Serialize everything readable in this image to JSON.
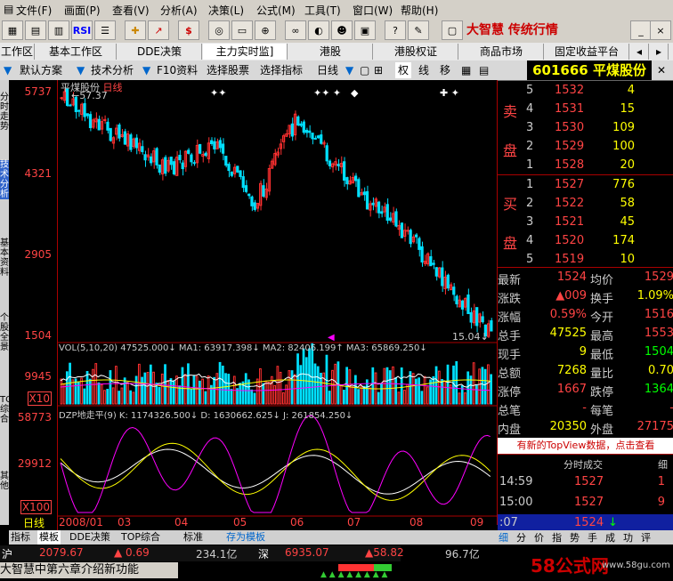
{
  "menu": {
    "items": [
      "文件(F)",
      "画面(P)",
      "查看(V)",
      "分析(A)",
      "决策(L)",
      "公式(M)",
      "工具(T)",
      "窗口(W)",
      "帮助(H)"
    ],
    "brand": "大智慧 传统行情"
  },
  "toolbar": {
    "rsi_label": "RSI",
    "dollar": "$"
  },
  "work_tabs": [
    "工作区",
    "基本工作区",
    "DDE决策",
    "主力实时监]",
    "港股",
    "港股权证",
    "商品市场",
    "固定收益平台"
  ],
  "func_bar": {
    "items": [
      "默认方案",
      "技术分析",
      "F10资料",
      "选择股票",
      "选择指标",
      "日线",
      "权",
      "线",
      "移"
    ],
    "stock_code": "601666",
    "stock_name": "平煤股份"
  },
  "side_labels": [
    "分时走势",
    "技术分析",
    "基本资料",
    "个股全景"
  ],
  "side_labels_lower": [
    "TOP综合",
    "其他"
  ],
  "chart": {
    "price_labels": [
      "5737",
      "4321",
      "2905",
      "1504"
    ],
    "title": "平煤股份",
    "period": "日线",
    "high_label": "57.37",
    "low_label": "15.04",
    "vol_legend": "VOL(5,10,20)  47525.000↓  MA1: 63917.398↓  MA2: 82406.199↑  MA3: 65869.250↓",
    "vol_labels": [
      "9945",
      "X10"
    ],
    "vol_last": "",
    "dzp_legend": "DZP地走平(9)  K: 1174326.500↓  D: 1630662.625↓  J: 261854.250↓",
    "dzp_labels": [
      "58773",
      "29912",
      "X100"
    ],
    "x_labels": [
      "2008/01",
      "03",
      "04",
      "05",
      "06",
      "07",
      "08",
      "09"
    ]
  },
  "chart_data": {
    "type": "candlestick",
    "title": "平煤股份 日线",
    "ylim": [
      1504,
      5737
    ],
    "x": [
      "2008/01",
      "03",
      "04",
      "05",
      "06",
      "07",
      "08",
      "09"
    ]
  },
  "bottom_tabs": [
    "指标",
    "模板",
    "DDE决策",
    "TOP综合",
    "标准",
    "存为模板"
  ],
  "sell": [
    {
      "level": "5",
      "price": "1532",
      "vol": "4"
    },
    {
      "level": "4",
      "price": "1531",
      "vol": "15"
    },
    {
      "level": "3",
      "price": "1530",
      "vol": "109"
    },
    {
      "level": "2",
      "price": "1529",
      "vol": "100"
    },
    {
      "level": "1",
      "price": "1528",
      "vol": "20"
    }
  ],
  "buy": [
    {
      "level": "1",
      "price": "1527",
      "vol": "776"
    },
    {
      "level": "2",
      "price": "1522",
      "vol": "58"
    },
    {
      "level": "3",
      "price": "1521",
      "vol": "45"
    },
    {
      "level": "4",
      "price": "1520",
      "vol": "174"
    },
    {
      "level": "5",
      "price": "1519",
      "vol": "10"
    }
  ],
  "sell_label": [
    "卖",
    "盘"
  ],
  "buy_label": [
    "买",
    "盘"
  ],
  "quote": [
    {
      "k1": "最新",
      "v1": "1524",
      "k2": "均价",
      "v2": "1529"
    },
    {
      "k1": "涨跌",
      "v1": "▲009",
      "k2": "换手",
      "v2": "1.09%"
    },
    {
      "k1": "涨幅",
      "v1": "0.59%",
      "k2": "今开",
      "v2": "1516"
    },
    {
      "k1": "总手",
      "v1": "47525",
      "k2": "最高",
      "v2": "1553"
    },
    {
      "k1": "现手",
      "v1": "9",
      "k2": "最低",
      "v2": "1504"
    },
    {
      "k1": "总额",
      "v1": "7268",
      "k2": "量比",
      "v2": "0.70"
    },
    {
      "k1": "涨停",
      "v1": "1667",
      "k2": "跌停",
      "v2": "1364"
    },
    {
      "k1": "总笔",
      "v1": "-",
      "k2": "每笔",
      "v2": "-"
    },
    {
      "k1": "内盘",
      "v1": "20350",
      "k2": "外盘",
      "v2": "27175"
    }
  ],
  "topview": "有新的TopView数据，点击查看",
  "ticks_header": "分时成交",
  "ticks_header_right": "细",
  "ticks": [
    {
      "t": "14:59",
      "p": "1527",
      "v": "1"
    },
    {
      "t": "15:00",
      "p": "1527",
      "v": "9"
    },
    {
      "t": ":07",
      "p": "1524",
      "v": ""
    }
  ],
  "panel_tabs": [
    "细",
    "分",
    "价",
    "指",
    "势",
    "手",
    "成",
    "功",
    "评"
  ],
  "status": {
    "s1_label": "沪",
    "s1_value": "2079.67",
    "s1_change": "▲ 0.69",
    "s1_amount": "234.1亿",
    "s2_label": "深",
    "s2_value": "6935.07",
    "s2_change": "▲58.82",
    "s2_amount": "96.7亿",
    "news": "大智慧中第六章介绍新功能",
    "watermark": "58公式网",
    "watermark_url": "www.58gu.com"
  },
  "colors": {
    "red": "#ff3030",
    "green": "#00ff00",
    "cyan": "#00e0ff",
    "yellow": "#ffff00"
  }
}
